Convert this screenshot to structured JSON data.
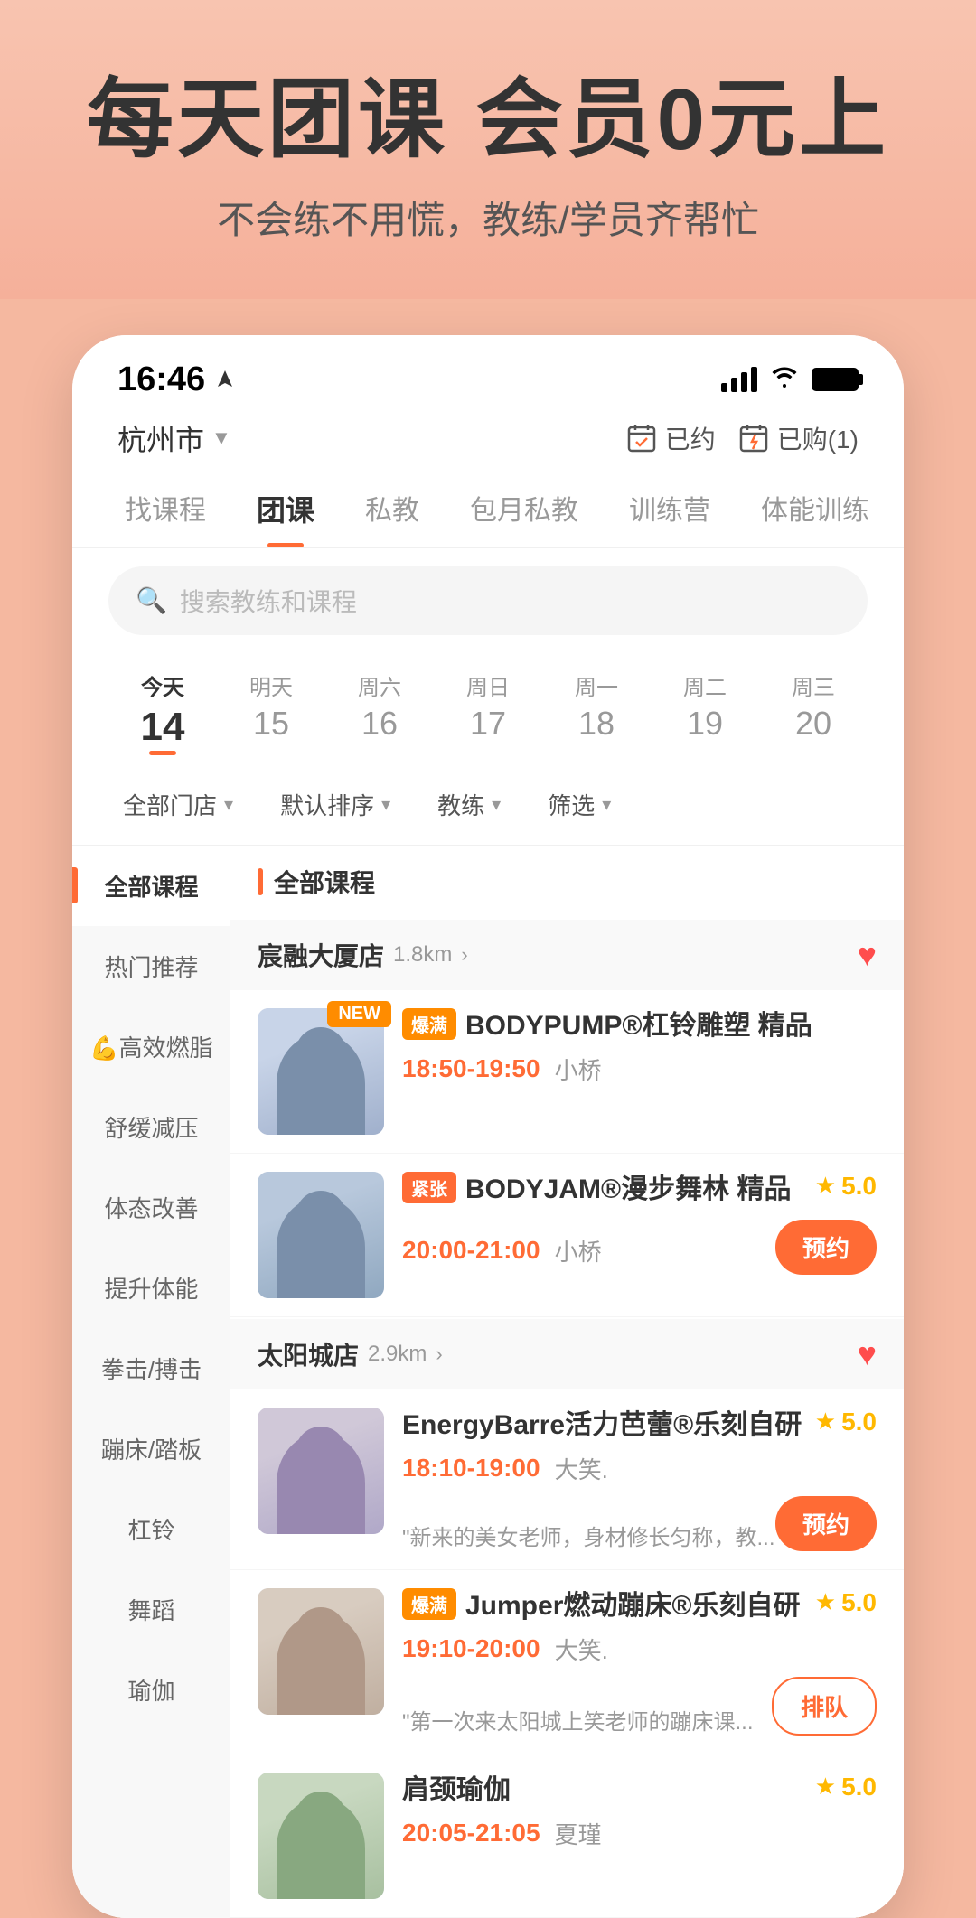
{
  "hero": {
    "title": "每天团课 会员0元上",
    "subtitle": "不会练不用慌，教练/学员齐帮忙"
  },
  "statusBar": {
    "time": "16:46",
    "locationIcon": "navigation-icon"
  },
  "topNav": {
    "location": "杭州市",
    "booked_label": "已约",
    "purchased_label": "已购(1)"
  },
  "tabs": [
    {
      "label": "找课程",
      "active": false
    },
    {
      "label": "团课",
      "active": true
    },
    {
      "label": "私教",
      "active": false
    },
    {
      "label": "包月私教",
      "active": false
    },
    {
      "label": "训练营",
      "active": false
    },
    {
      "label": "体能训练",
      "active": false
    }
  ],
  "search": {
    "placeholder": "搜索教练和课程"
  },
  "dates": [
    {
      "label": "今天",
      "num": "14",
      "active": true
    },
    {
      "label": "明天",
      "num": "15",
      "active": false
    },
    {
      "label": "周六",
      "num": "16",
      "active": false
    },
    {
      "label": "周日",
      "num": "17",
      "active": false
    },
    {
      "label": "周一",
      "num": "18",
      "active": false
    },
    {
      "label": "周二",
      "num": "19",
      "active": false
    },
    {
      "label": "周三",
      "num": "20",
      "active": false
    }
  ],
  "filters": [
    {
      "label": "全部门店"
    },
    {
      "label": "默认排序"
    },
    {
      "label": "教练"
    },
    {
      "label": "筛选"
    }
  ],
  "sidebar": {
    "items": [
      {
        "label": "全部课程",
        "active": true
      },
      {
        "label": "热门推荐",
        "active": false
      },
      {
        "label": "💪高效燃脂",
        "active": false
      },
      {
        "label": "舒缓减压",
        "active": false
      },
      {
        "label": "体态改善",
        "active": false
      },
      {
        "label": "提升体能",
        "active": false
      },
      {
        "label": "拳击/搏击",
        "active": false
      },
      {
        "label": "蹦床/踏板",
        "active": false
      },
      {
        "label": "杠铃",
        "active": false
      },
      {
        "label": "舞蹈",
        "active": false
      },
      {
        "label": "瑜伽",
        "active": false
      }
    ]
  },
  "stores": [
    {
      "name": "宸融大厦店",
      "distance": "1.8km",
      "favorited": true,
      "courses": [
        {
          "badge": "爆满",
          "badgeType": "full",
          "name": "BODYPUMP®杠铃雕塑 精品",
          "isNew": true,
          "time": "18:50-19:50",
          "trainer": "小桥",
          "rating": null,
          "action": null,
          "desc": null
        },
        {
          "badge": "紧张",
          "badgeType": "tight",
          "name": "BODYJAM®漫步舞林 精品",
          "isNew": false,
          "time": "20:00-21:00",
          "trainer": "小桥",
          "rating": "5.0",
          "action": "预约",
          "desc": null
        }
      ]
    },
    {
      "name": "太阳城店",
      "distance": "2.9km",
      "favorited": true,
      "courses": [
        {
          "badge": null,
          "badgeType": null,
          "name": "EnergyBarre活力芭蕾®乐刻自研",
          "isNew": false,
          "time": "18:10-19:00",
          "trainer": "大笑.",
          "rating": "5.0",
          "action": "预约",
          "desc": "\"新来的美女老师，身材修长匀称，教..."
        },
        {
          "badge": "爆满",
          "badgeType": "full",
          "name": "Jumper燃动蹦床®乐刻自研",
          "isNew": false,
          "time": "19:10-20:00",
          "trainer": "大笑.",
          "rating": "5.0",
          "action": "排队",
          "actionType": "queue",
          "desc": "\"第一次来太阳城上笑老师的蹦床课..."
        },
        {
          "badge": null,
          "badgeType": null,
          "name": "肩颈瑜伽",
          "isNew": false,
          "time": "20:05-21:05",
          "trainer": "夏瑾",
          "rating": "5.0",
          "action": null,
          "desc": null
        }
      ]
    }
  ]
}
